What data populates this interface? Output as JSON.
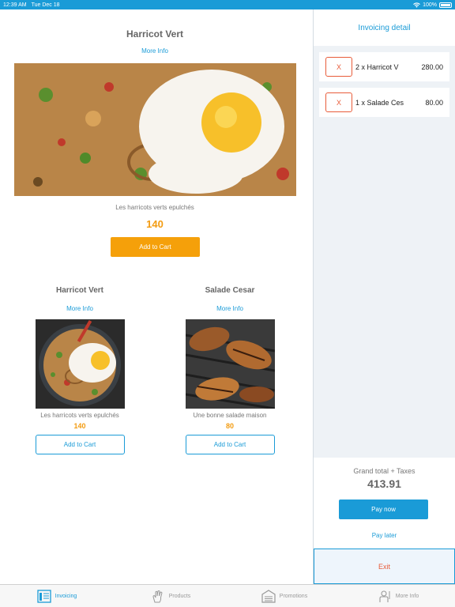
{
  "status_bar": {
    "time": "12:39 AM",
    "date": "Tue Dec 18",
    "battery": "100%"
  },
  "featured": {
    "title": "Harricot Vert",
    "more_info": "More Info",
    "description": "Les harricots verts epulchés",
    "price": "140",
    "add_to_cart": "Add to Cart",
    "image": "fried-rice-with-egg-photo"
  },
  "products": [
    {
      "title": "Harricot Vert",
      "more_info": "More Info",
      "description": "Les harricots verts epulchés",
      "price": "140",
      "add_to_cart": "Add to Cart",
      "image": "fried-rice-with-egg-photo"
    },
    {
      "title": "Salade Cesar",
      "more_info": "More Info",
      "description": "Une bonne salade maison",
      "price": "80",
      "add_to_cart": "Add to Cart",
      "image": "grilled-chicken-photo"
    }
  ],
  "invoice": {
    "title": "Invoicing detail",
    "items": [
      {
        "remove": "X",
        "name": "2 x Harricot V",
        "amount": "280.00"
      },
      {
        "remove": "X",
        "name": "1 x Salade Ces",
        "amount": "80.00"
      }
    ],
    "grand_total_label": "Grand total + Taxes",
    "grand_total_value": "413.91",
    "pay_now": "Pay now",
    "pay_later": "Pay later",
    "exit": "Exit"
  },
  "tabs": [
    {
      "label": "Invoicing",
      "icon": "invoice-icon",
      "active": true
    },
    {
      "label": "Products",
      "icon": "hand-icon",
      "active": false
    },
    {
      "label": "Promotions",
      "icon": "store-icon",
      "active": false
    },
    {
      "label": "More Info",
      "icon": "person-icon",
      "active": false
    }
  ],
  "colors": {
    "accent": "#1a9bd7",
    "price": "#f39c12",
    "danger": "#e85c3a",
    "add_button": "#f5a00a"
  }
}
